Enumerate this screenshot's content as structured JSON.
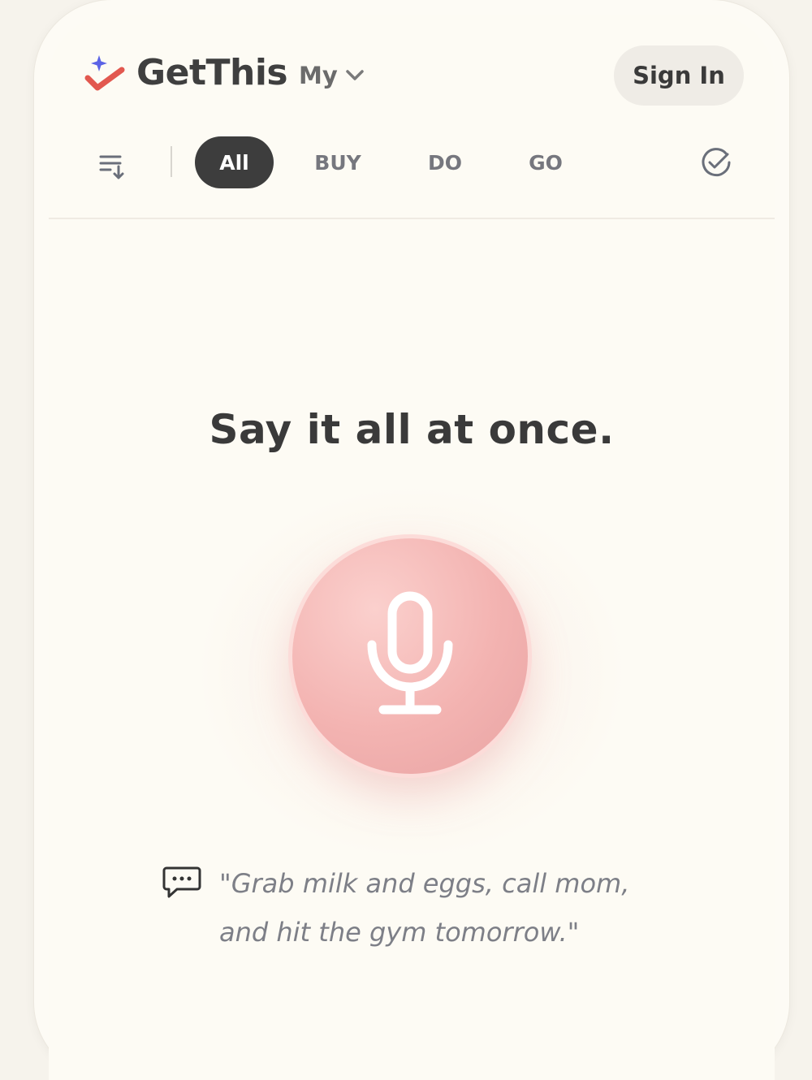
{
  "header": {
    "brand": "GetThis",
    "list_selector": "My",
    "sign_in_label": "Sign In"
  },
  "filters": {
    "tabs": [
      {
        "label": "All",
        "active": true
      },
      {
        "label": "BUY",
        "active": false
      },
      {
        "label": "DO",
        "active": false
      },
      {
        "label": "GO",
        "active": false
      }
    ]
  },
  "main": {
    "headline": "Say it all at once.",
    "example_line1": "\"Grab milk and eggs, call mom,",
    "example_line2": "and hit the gym tomorrow.\""
  },
  "colors": {
    "brand_check": "#e2584f",
    "brand_sparkle": "#5b63e6",
    "tab_active_bg": "#3d3d3d",
    "mic_button": "#f3b3b1"
  },
  "icons": {
    "logo": "check-sparkle-icon",
    "dropdown": "chevron-down-icon",
    "sort": "sort-list-icon",
    "completed": "check-circle-icon",
    "mic": "microphone-icon",
    "example": "chat-bubble-icon"
  }
}
